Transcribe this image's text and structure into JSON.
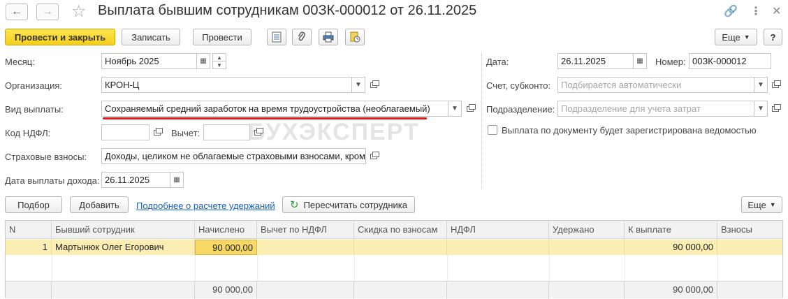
{
  "window": {
    "title": "Выплата бывшим сотрудникам 00ЗК-000012 от 26.11.2025"
  },
  "toolbar": {
    "post_and_close": "Провести и закрыть",
    "save": "Записать",
    "post": "Провести",
    "more": "Еще",
    "help": "?"
  },
  "form": {
    "month": {
      "label": "Месяц:",
      "value": "Ноябрь 2025"
    },
    "organization": {
      "label": "Организация:",
      "value": "КРОН-Ц"
    },
    "payment_type": {
      "label": "Вид выплаты:",
      "value": "Сохраняемый средний заработок на время трудоустройства (необлагаемый)"
    },
    "ndfl_code": {
      "label": "Код НДФЛ:",
      "value": ""
    },
    "deduction": {
      "label": "Вычет:",
      "value": ""
    },
    "insurance": {
      "label": "Страховые взносы:",
      "value": "Доходы, целиком не облагаемые страховыми взносами, кром"
    },
    "income_date": {
      "label": "Дата выплаты дохода:",
      "value": "26.11.2025"
    },
    "date": {
      "label": "Дата:",
      "value": "26.11.2025"
    },
    "number": {
      "label": "Номер:",
      "value": "00ЗК-000012"
    },
    "account": {
      "label": "Счет, субконто:",
      "placeholder": "Подбирается автоматически"
    },
    "department": {
      "label": "Подразделение:",
      "placeholder": "Подразделение для учета затрат"
    },
    "statement_checkbox": {
      "label": "Выплата по документу будет зарегистрирована ведомостью"
    }
  },
  "watermark": "БУХЭКСПЕРТ",
  "table_toolbar": {
    "select": "Подбор",
    "add": "Добавить",
    "details_link": "Подробнее о расчете удержаний",
    "recalc": "Пересчитать сотрудника",
    "more": "Еще"
  },
  "table": {
    "columns": [
      "N",
      "Бывший сотрудник",
      "Начислено",
      "Вычет по НДФЛ",
      "Скидка по взносам",
      "НДФЛ",
      "Удержано",
      "К выплате",
      "Взносы"
    ],
    "rows": [
      {
        "n": "1",
        "employee": "Мартынюк Олег Егорович",
        "accrued": "90 000,00",
        "payout": "90 000,00"
      }
    ],
    "totals": {
      "accrued": "90 000,00",
      "payout": "90 000,00"
    }
  },
  "colors": {
    "primary_button": "#f5cf1c",
    "selected_row": "#fbeeb2",
    "underline": "#e01818",
    "link": "#1a5fb4"
  }
}
